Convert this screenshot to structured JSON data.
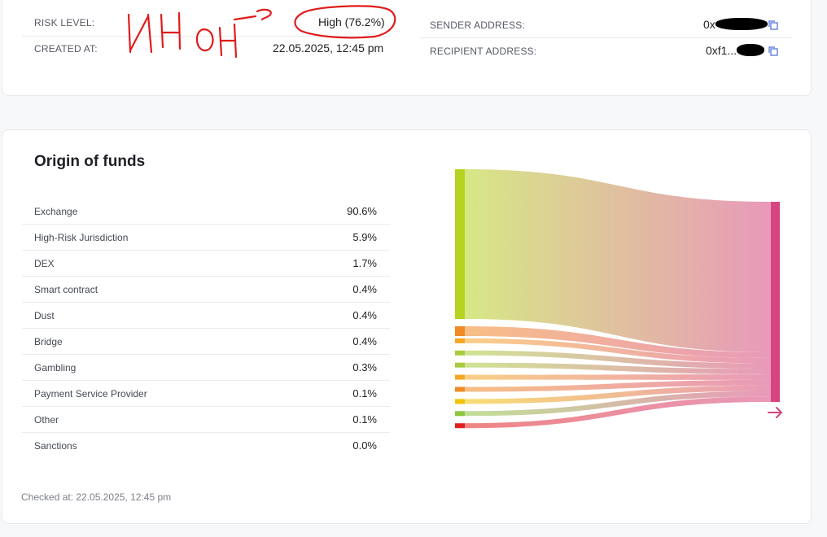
{
  "summary": {
    "risk_level_label": "RISK LEVEL:",
    "risk_level_value": "High (76.2%)",
    "created_at_label": "CREATED AT:",
    "created_at_value": "22.05.2025, 12:45 pm",
    "sender_label": "SENDER ADDRESS:",
    "sender_value": "0x",
    "recipient_label": "RECIPIENT ADDRESS:",
    "recipient_value": "0xf1..."
  },
  "annotation": {
    "handwritten_text": "ИН ОН?",
    "color": "#e01b1b"
  },
  "funds": {
    "title": "Origin of funds",
    "rows": [
      {
        "category": "Exchange",
        "percent": "90.6%",
        "color": "#b5d420"
      },
      {
        "category": "High-Risk Jurisdiction",
        "percent": "5.9%",
        "color": "#f08a24"
      },
      {
        "category": "DEX",
        "percent": "1.7%",
        "color": "#f5a623"
      },
      {
        "category": "Smart contract",
        "percent": "0.4%",
        "color": "#a8cc3c"
      },
      {
        "category": "Dust",
        "percent": "0.4%",
        "color": "#a8cc3c"
      },
      {
        "category": "Bridge",
        "percent": "0.4%",
        "color": "#f5a623"
      },
      {
        "category": "Gambling",
        "percent": "0.3%",
        "color": "#f08a24"
      },
      {
        "category": "Payment Service Provider",
        "percent": "0.1%",
        "color": "#f2c200"
      },
      {
        "category": "Other",
        "percent": "0.1%",
        "color": "#8cc63f"
      },
      {
        "category": "Sanctions",
        "percent": "0.0%",
        "color": "#e02020"
      }
    ],
    "checked_at": "Checked at: 22.05.2025, 12:45 pm",
    "target_color": "#d6457f"
  }
}
